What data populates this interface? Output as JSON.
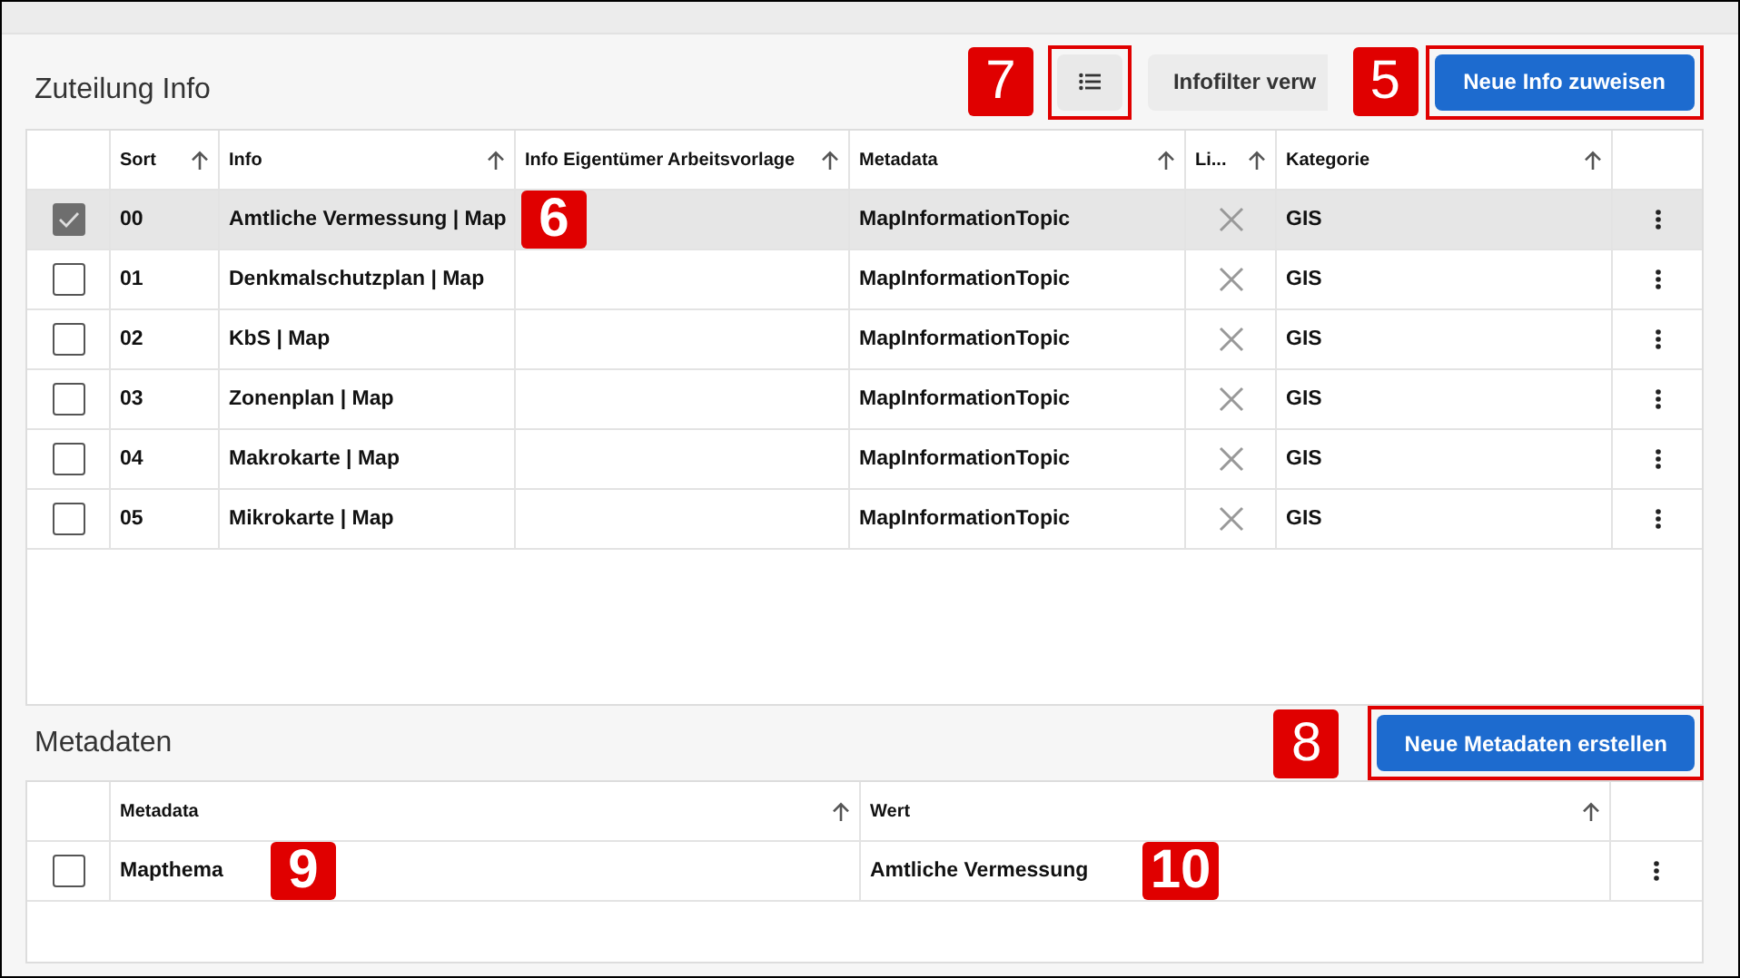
{
  "zuteilung": {
    "title": "Zuteilung Info",
    "toolbar": [
      {
        "kind": "icon",
        "callout": "7",
        "boxed": true
      },
      {
        "kind": "secondary",
        "label": "Infofilter verw"
      },
      {
        "kind": "primary",
        "label": "Neue Info zuweisen",
        "callout": "5",
        "boxed": true
      }
    ],
    "columns": [
      "Sort",
      "Info",
      "Info Eigentümer Arbeitsvorlage",
      "Metadata",
      "Li...",
      "Kategorie"
    ],
    "rows": [
      {
        "selected": true,
        "sort": "00",
        "info": "Amtliche Vermessung | Map",
        "metadata": "MapInformationTopic",
        "li": false,
        "kategorie": "GIS",
        "callout": "6"
      },
      {
        "selected": false,
        "sort": "01",
        "info": "Denkmalschutzplan | Map",
        "metadata": "MapInformationTopic",
        "li": false,
        "kategorie": "GIS"
      },
      {
        "selected": false,
        "sort": "02",
        "info": "KbS | Map",
        "metadata": "MapInformationTopic",
        "li": false,
        "kategorie": "GIS"
      },
      {
        "selected": false,
        "sort": "03",
        "info": "Zonenplan | Map",
        "metadata": "MapInformationTopic",
        "li": false,
        "kategorie": "GIS"
      },
      {
        "selected": false,
        "sort": "04",
        "info": "Makrokarte | Map",
        "metadata": "MapInformationTopic",
        "li": false,
        "kategorie": "GIS"
      },
      {
        "selected": false,
        "sort": "05",
        "info": "Mikrokarte | Map",
        "metadata": "MapInformationTopic",
        "li": false,
        "kategorie": "GIS"
      }
    ]
  },
  "metadaten": {
    "title": "Metadaten",
    "button": {
      "label": "Neue Metadaten erstellen",
      "callout": "8",
      "boxed": true
    },
    "columns": [
      "Metadata",
      "Wert"
    ],
    "rows": [
      {
        "selected": false,
        "metadata": "Mapthema",
        "wert": "Amtliche Vermessung",
        "callouts": [
          "9",
          "10"
        ]
      }
    ]
  }
}
